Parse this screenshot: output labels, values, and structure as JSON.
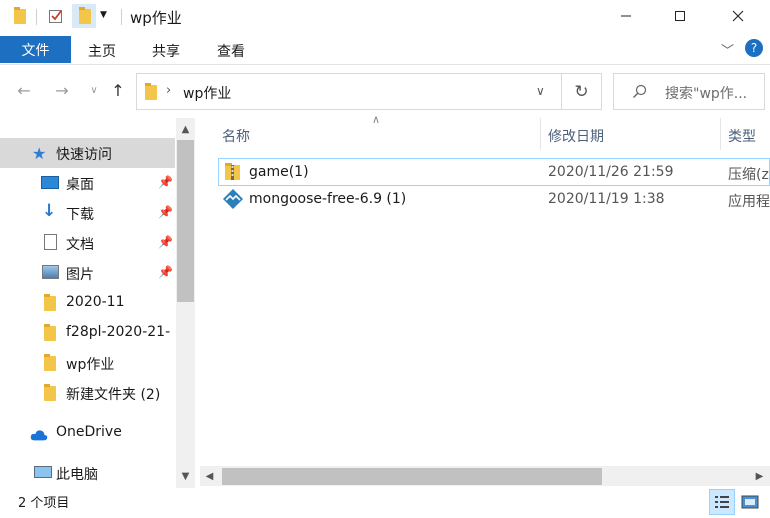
{
  "window": {
    "title": "wp作业",
    "minimize_icon": "minimize-icon",
    "maximize_icon": "maximize-icon",
    "close_icon": "close-icon"
  },
  "ribbon": {
    "file": "文件",
    "tabs": [
      "主页",
      "共享",
      "查看"
    ]
  },
  "address": {
    "path": "wp作业",
    "search_placeholder": "搜索\"wp作..."
  },
  "nav": {
    "quick_access": "快速访问",
    "items": [
      {
        "label": "桌面",
        "icon": "desktop-icon",
        "pinned": true
      },
      {
        "label": "下载",
        "icon": "download-icon",
        "pinned": true
      },
      {
        "label": "文档",
        "icon": "document-icon",
        "pinned": true
      },
      {
        "label": "图片",
        "icon": "picture-icon",
        "pinned": true
      },
      {
        "label": "2020-11",
        "icon": "folder-icon",
        "pinned": false
      },
      {
        "label": "f28pl-2020-21-",
        "icon": "folder-icon",
        "pinned": false
      },
      {
        "label": "wp作业",
        "icon": "folder-icon",
        "pinned": false
      },
      {
        "label": "新建文件夹 (2)",
        "icon": "folder-icon",
        "pinned": false
      }
    ],
    "onedrive": "OneDrive",
    "this_pc": "此电脑"
  },
  "columns": {
    "name": "名称",
    "modified": "修改日期",
    "type": "类型"
  },
  "files": [
    {
      "name": "game(1)",
      "modified": "2020/11/26 21:59",
      "type": "压缩(z",
      "icon": "zip-folder-icon"
    },
    {
      "name": "mongoose-free-6.9 (1)",
      "modified": "2020/11/19 1:38",
      "type": "应用程",
      "icon": "mongoose-app-icon"
    }
  ],
  "status": {
    "count": "2 个项目"
  },
  "colors": {
    "accent": "#1c6fc1",
    "selection": "#cce8ff",
    "hover_border": "#99d1ff"
  }
}
